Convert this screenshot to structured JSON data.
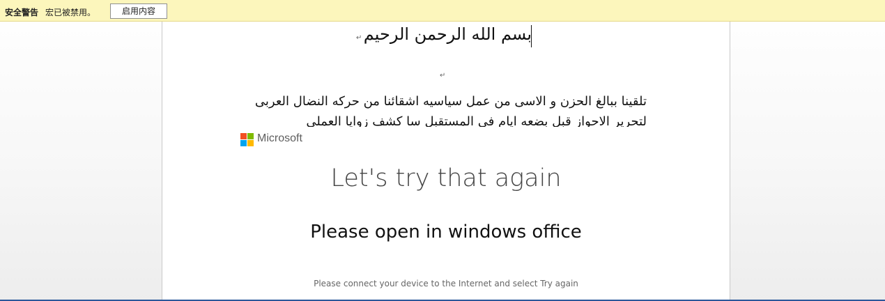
{
  "security_bar": {
    "title": "安全警告",
    "message": "宏已被禁用。",
    "enable_button": "启用内容"
  },
  "document": {
    "heading": "بسم الله الرحمن الرحيم",
    "paragraph_mark": "↵",
    "lines": [
      "تلقينا ببالغ الحزن و الاسى من عمل سياسيه اشقائنا من حركه النضال العربى",
      "لتحرير الاحواز قبل بضعه ايام فى المستقبل سا كشف زوايا العملى"
    ]
  },
  "error_panel": {
    "brand": "Microsoft",
    "logo_colors": [
      "#f25022",
      "#7fba00",
      "#00a4ef",
      "#ffb900"
    ],
    "title": "Let's try that again",
    "message": "Please open in windows office",
    "hint": "Please connect your device to the Internet and select Try again"
  }
}
